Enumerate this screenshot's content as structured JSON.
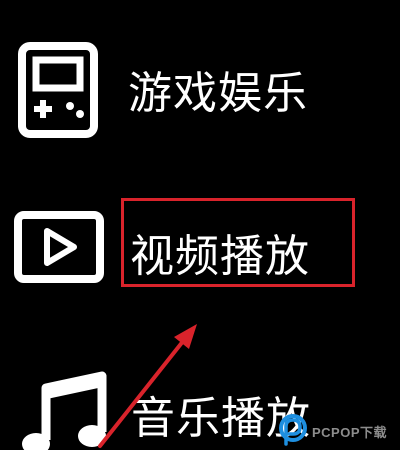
{
  "menu": {
    "items": [
      {
        "label": "游戏娱乐",
        "icon": "gamepad-icon"
      },
      {
        "label": "视频播放",
        "icon": "video-play-icon"
      },
      {
        "label": "音乐播放",
        "icon": "music-note-icon"
      }
    ],
    "highlighted_index": 1
  },
  "colors": {
    "background": "#000000",
    "foreground": "#ffffff",
    "highlight": "#d9232b",
    "watermark_blue": "#1e8fe0"
  },
  "watermark": {
    "text": "PCPOP下载"
  }
}
